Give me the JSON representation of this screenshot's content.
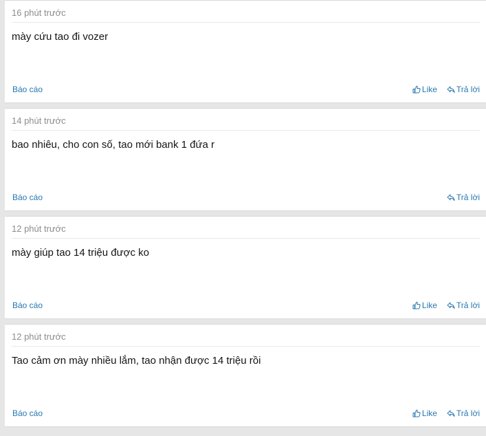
{
  "labels": {
    "report": "Báo cáo",
    "like": "Like",
    "reply": "Trả lời"
  },
  "posts": [
    {
      "time": "16 phút trước",
      "content": "mày cứu tao đi vozer",
      "show_like": true
    },
    {
      "time": "14 phút trước",
      "content": "bao nhiêu, cho con số, tao mới bank 1 đứa r",
      "show_like": false
    },
    {
      "time": "12 phút trước",
      "content": "mày giúp tao 14 triệu được ko",
      "show_like": true
    },
    {
      "time": "12 phút trước",
      "content": "Tao cảm ơn mày nhiều lắm, tao nhận được 14 triệu rồi",
      "show_like": true
    }
  ]
}
